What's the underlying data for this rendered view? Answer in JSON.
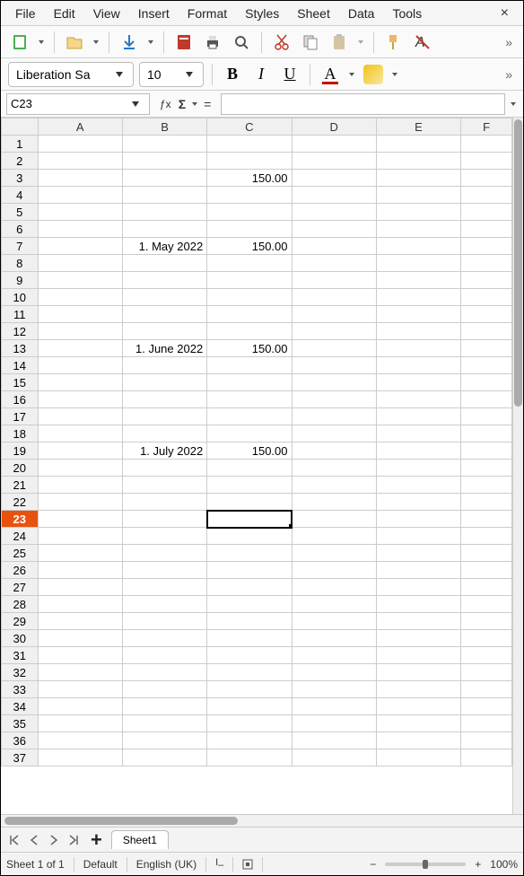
{
  "menu": {
    "items": [
      "File",
      "Edit",
      "View",
      "Insert",
      "Format",
      "Styles",
      "Sheet",
      "Data",
      "Tools"
    ],
    "close": "×"
  },
  "toolbar2": {
    "font_name": "Liberation Sa",
    "font_size": "10"
  },
  "formula_row": {
    "cell_ref": "C23",
    "fx_label": "ƒx",
    "sigma": "Σ",
    "eq": "=",
    "formula_value": ""
  },
  "grid": {
    "columns": [
      "A",
      "B",
      "C",
      "D",
      "E",
      "F"
    ],
    "selected_column": "C",
    "selected_row": 23,
    "rows": 37,
    "cells": {
      "3": {
        "C": "150.00"
      },
      "7": {
        "B": "1. May 2022",
        "C": "150.00"
      },
      "13": {
        "B": "1. June 2022",
        "C": "150.00"
      },
      "19": {
        "B": "1. July 2022",
        "C": "150.00"
      }
    }
  },
  "tabs": {
    "sheet_name": "Sheet1",
    "add_label": "+"
  },
  "status": {
    "sheet_count": "Sheet 1 of 1",
    "style": "Default",
    "language": "English (UK)",
    "zoom_minus": "−",
    "zoom_plus": "+",
    "zoom_pct": "100%"
  }
}
